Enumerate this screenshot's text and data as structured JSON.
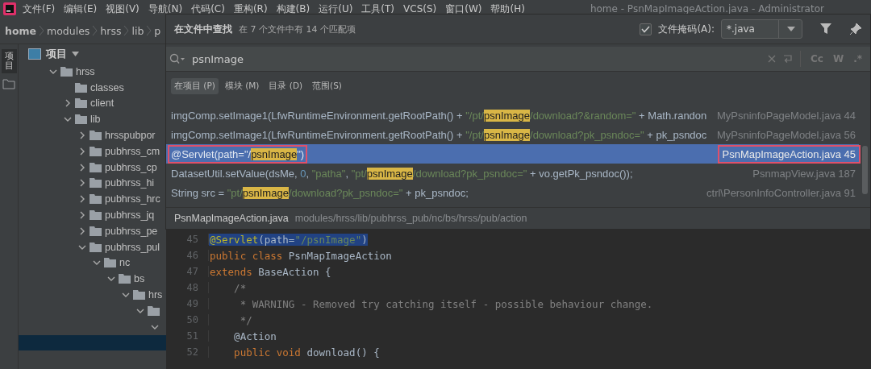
{
  "menu_bar": {
    "items": [
      "文件(F)",
      "编辑(E)",
      "视图(V)",
      "导航(N)",
      "代码(C)",
      "重构(R)",
      "构建(B)",
      "运行(U)",
      "工具(T)",
      "VCS(S)",
      "窗口(W)",
      "帮助(H)"
    ],
    "title": "home - PsnMapImageAction.java - Administrator"
  },
  "breadcrumb": [
    "home",
    "modules",
    "hrss",
    "lib",
    "p"
  ],
  "side_strip": {
    "label": "项目"
  },
  "project_panel": {
    "title": "项目",
    "tree": [
      {
        "name": "hrss",
        "expanded": true,
        "folder": true,
        "selected": false,
        "children": [
          {
            "name": "classes",
            "folder": true,
            "selected": false
          },
          {
            "name": "client",
            "expanded": false,
            "folder": true,
            "selected": false
          },
          {
            "name": "lib",
            "expanded": true,
            "folder": true,
            "selected": false,
            "children": [
              {
                "name": "hrsspubpor",
                "expanded": false,
                "folder": true,
                "selected": false
              },
              {
                "name": "pubhrss_cm",
                "expanded": false,
                "folder": true,
                "selected": false
              },
              {
                "name": "pubhrss_cp",
                "expanded": false,
                "folder": true,
                "selected": false
              },
              {
                "name": "pubhrss_hi",
                "expanded": false,
                "folder": true,
                "selected": false
              },
              {
                "name": "pubhrss_hrc",
                "expanded": false,
                "folder": true,
                "selected": false
              },
              {
                "name": "pubhrss_jq",
                "expanded": false,
                "folder": true,
                "selected": false
              },
              {
                "name": "pubhrss_pe",
                "expanded": false,
                "folder": true,
                "selected": false
              },
              {
                "name": "pubhrss_pul",
                "expanded": true,
                "folder": true,
                "selected": false,
                "children": [
                  {
                    "name": "nc",
                    "expanded": true,
                    "folder": true,
                    "selected": false,
                    "children": [
                      {
                        "name": "bs",
                        "expanded": true,
                        "folder": true,
                        "selected": false,
                        "children": [
                          {
                            "name": "hrs",
                            "expanded": true,
                            "folder": true,
                            "selected": false,
                            "children": [
                              {
                                "expanded": true,
                                "folder": true,
                                "selected": false,
                                "children": [
                                  {
                                    "expanded": true,
                                    "folder": false,
                                    "selected": false,
                                    "children": [
                                      {
                                        "folder": false,
                                        "selected": true
                                      }
                                    ]
                                  }
                                ]
                              }
                            ]
                          }
                        ]
                      }
                    ]
                  }
                ]
              }
            ]
          }
        ]
      }
    ]
  },
  "find_dialog": {
    "title": "在文件中查找",
    "summary": "在 7 个文件中有 14 个匹配项",
    "file_mask": {
      "checked": true,
      "label": "文件掩码(A):",
      "value": "*.java"
    },
    "search": {
      "value": "psnImage",
      "options": [
        "Cc",
        "W",
        ".*"
      ]
    },
    "scopes": [
      {
        "label": "在项目 (P)",
        "selected": true
      },
      {
        "label": "模块 (M)",
        "selected": false
      },
      {
        "label": "目录 (D)",
        "selected": false
      },
      {
        "label": "范围(S)",
        "selected": false
      }
    ],
    "results": [
      {
        "selected": false,
        "marked": false,
        "file": "MyPsninfoPageModel.java 44",
        "parts": [
          {
            "kind": "plain",
            "text": "imgComp.setImage1(LfwRuntimeEnvironment.getRootPath() + "
          },
          {
            "kind": "string",
            "text": "\"/pt/"
          },
          {
            "kind": "match",
            "text": "psnImage"
          },
          {
            "kind": "string",
            "text": "/download?&random=\""
          },
          {
            "kind": "plain",
            "text": " + Math.randon"
          }
        ]
      },
      {
        "selected": false,
        "marked": false,
        "file": "MyPsninfoPageModel.java 56",
        "parts": [
          {
            "kind": "plain",
            "text": "imgComp.setImage1(LfwRuntimeEnvironment.getRootPath() + "
          },
          {
            "kind": "string",
            "text": "\"/pt/"
          },
          {
            "kind": "match",
            "text": "psnImage"
          },
          {
            "kind": "string",
            "text": "/download?pk_psndoc=\""
          },
          {
            "kind": "plain",
            "text": " + pk_psndoc"
          }
        ]
      },
      {
        "selected": true,
        "marked": true,
        "file": "PsnMapImageAction.java 45",
        "parts": [
          {
            "kind": "plain",
            "text": "@Servlet(path="
          },
          {
            "kind": "string",
            "text": "\"/"
          },
          {
            "kind": "match",
            "text": "psnImage"
          },
          {
            "kind": "string",
            "text": "\")"
          }
        ]
      },
      {
        "selected": false,
        "marked": false,
        "file": "PsnmapView.java 187",
        "parts": [
          {
            "kind": "plain",
            "text": "DatasetUtil.setValue(dsMe, "
          },
          {
            "kind": "number",
            "text": "0"
          },
          {
            "kind": "plain",
            "text": ", "
          },
          {
            "kind": "string",
            "text": "\"patha\""
          },
          {
            "kind": "plain",
            "text": ", "
          },
          {
            "kind": "string",
            "text": "\"pt/"
          },
          {
            "kind": "match",
            "text": "psnImage"
          },
          {
            "kind": "string",
            "text": "/download?pk_psndoc=\""
          },
          {
            "kind": "plain",
            "text": " + vo.getPk_psndoc());"
          }
        ]
      },
      {
        "selected": false,
        "marked": false,
        "file": "ctrl\\PersonInfoController.java 91",
        "parts": [
          {
            "kind": "plain",
            "text": "String src = "
          },
          {
            "kind": "string",
            "text": "\"pt/"
          },
          {
            "kind": "match",
            "text": "psnImage"
          },
          {
            "kind": "string",
            "text": "/download?pk_psndoc=\""
          },
          {
            "kind": "plain",
            "text": " + pk_psndoc;"
          }
        ]
      }
    ],
    "preview": {
      "file": "PsnMapImageAction.java",
      "path": "modules/hrss/lib/pubhrss_pub/nc/bs/hrss/pub/action"
    }
  },
  "editor": {
    "lines": [
      {
        "number": "45",
        "selected": true,
        "parts": [
          {
            "kind": "annotation",
            "text": "@Servlet"
          },
          {
            "kind": "plain",
            "text": "(path="
          },
          {
            "kind": "string",
            "text": "\"/psnImage\""
          },
          {
            "kind": "plain",
            "text": ")"
          }
        ]
      },
      {
        "number": "46",
        "selected": false,
        "parts": [
          {
            "kind": "keyword",
            "text": "public class "
          },
          {
            "kind": "plain",
            "text": "PsnMapImageAction"
          }
        ]
      },
      {
        "number": "47",
        "selected": false,
        "parts": [
          {
            "kind": "keyword",
            "text": "extends "
          },
          {
            "kind": "plain",
            "text": "BaseAction {"
          }
        ]
      },
      {
        "number": "48",
        "selected": false,
        "parts": [
          {
            "kind": "comment",
            "text": "    /*"
          }
        ]
      },
      {
        "number": "49",
        "selected": false,
        "parts": [
          {
            "kind": "comment",
            "text": "     * WARNING - Removed try catching itself - possible behaviour change."
          }
        ]
      },
      {
        "number": "50",
        "selected": false,
        "parts": [
          {
            "kind": "comment",
            "text": "     */"
          }
        ]
      },
      {
        "number": "51",
        "selected": false,
        "parts": [
          {
            "kind": "plain",
            "text": "    @Action"
          }
        ]
      },
      {
        "number": "52",
        "selected": false,
        "parts": [
          {
            "kind": "keyword",
            "text": "    public void "
          },
          {
            "kind": "plain",
            "text": "download() {"
          }
        ]
      }
    ]
  }
}
